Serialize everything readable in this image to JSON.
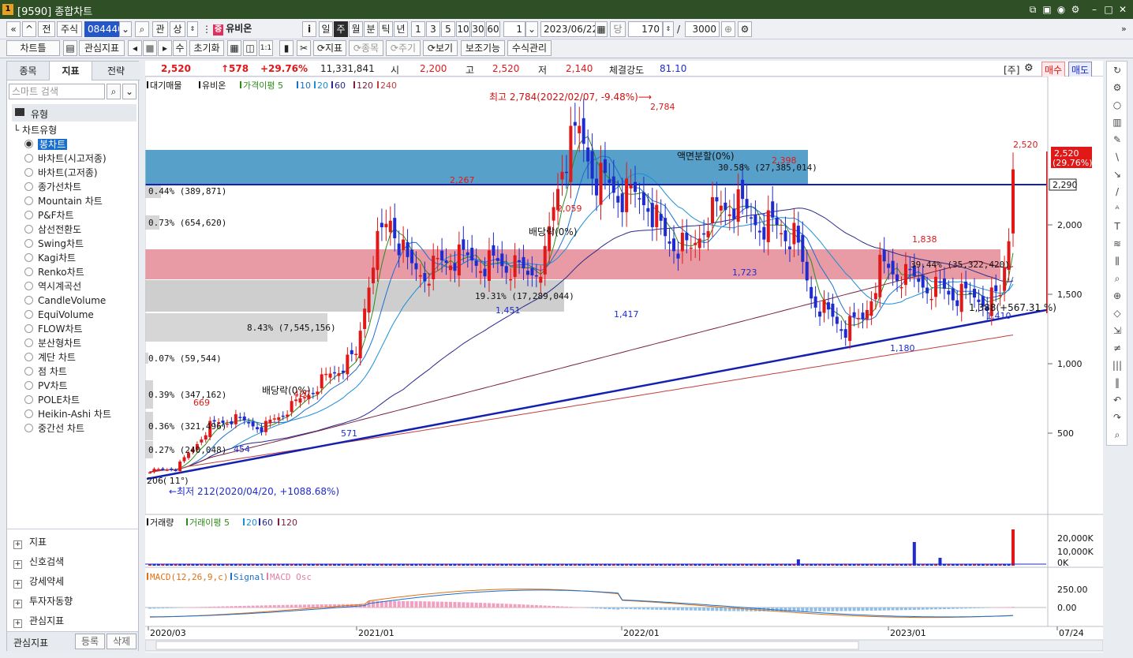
{
  "window": {
    "title": "[9590] 종합차트",
    "badge1": "1",
    "badge2": "?"
  },
  "toolbar1": {
    "nav1": "«",
    "nav2": "≈",
    "prev": "전",
    "type": "주식",
    "code": "084440",
    "btn_gwan": "관",
    "btn_sang": "상",
    "stock_name": "유비온",
    "stock_badge": "증",
    "periods": [
      "일",
      "주",
      "월",
      "분",
      "틱",
      "년"
    ],
    "active_period": "주",
    "nums": [
      "1",
      "3",
      "5",
      "10",
      "30",
      "60"
    ],
    "unit": "1",
    "date": "2023/06/22",
    "dang": "당",
    "count": "170",
    "slash": "/",
    "total": "3000"
  },
  "toolbar2": {
    "chart_btn": "차트틀",
    "fav_btn": "관심지표",
    "su": "수",
    "reset": "초기화",
    "indicator": "지표",
    "jongmok": "종목",
    "jugi": "주기",
    "view": "보기",
    "aux": "보조기능",
    "formula": "수식관리"
  },
  "left_panel": {
    "tabs": [
      "종목",
      "지표",
      "전략"
    ],
    "active_tab": "지표",
    "search_placeholder": "스마트 검색",
    "folder": "유형",
    "group": "차트유형",
    "chart_types": [
      "봉차트",
      "바차트(시고저종)",
      "바차트(고저종)",
      "종가선차트",
      "Mountain 차트",
      "P&F차트",
      "삼선전환도",
      "Swing차트",
      "Kagi차트",
      "Renko차트",
      "역시계곡선",
      "CandleVolume",
      "EquiVolume",
      "FLOW차트",
      "분산형차트",
      "계단 차트",
      "점 차트",
      "PV차트",
      "POLE차트",
      "Heikin-Ashi 차트",
      "중간선 차트"
    ],
    "selected": "봉차트",
    "sections": [
      "지표",
      "신호검색",
      "강세약세",
      "투자자동향",
      "관심지표"
    ],
    "footer_label": "관심지표",
    "footer_register": "등록",
    "footer_delete": "삭제"
  },
  "info": {
    "price": "2,520",
    "change": "↑578",
    "pct": "+29.76%",
    "volume": "11,331,841",
    "open_l": "시",
    "open": "2,200",
    "high_l": "고",
    "high": "2,520",
    "low_l": "저",
    "low": "2,140",
    "str_l": "체결강도",
    "str": "81.10",
    "ju": "[주]",
    "buy": "매수",
    "sell": "매도"
  },
  "price_legend": {
    "a": "대기매물",
    "b": "유비온",
    "c": "가격이평 5",
    "d": "10",
    "e": "20",
    "f": "60",
    "g": "120",
    "h": "240"
  },
  "annotations": {
    "high": "최고 2,784(2022/02/07, -9.48%)",
    "low": "←최저 212(2020/04/20, +1088.68%)",
    "div1": "배당락(0%)",
    "div2": "배당락(0%)",
    "split": "액면분할(0%)",
    "trend1": "1,388(+567.31 %)",
    "angle": "206( 11°)"
  },
  "point_labels": [
    "2,784",
    "2,267",
    "2,059",
    "2,398",
    "2,520",
    "1,838",
    "1,723",
    "1,451",
    "1,417",
    "1,180",
    "1,410",
    "669",
    "571",
    "454",
    "420"
  ],
  "price_axis": {
    "ticks": [
      "2,000",
      "1,500",
      "1,000",
      "500"
    ],
    "last": "2,520",
    "last_pct": "(29.76%)",
    "line": "2,290"
  },
  "volume_profile": [
    "0.44% (389,871)",
    "0.73% (654,620)",
    "30.58% (27,385,014)",
    "39.44% (35,322,420)",
    "19.31% (17,289,044)",
    "8.43% (7,545,156)",
    "0.07% (59,544)",
    "0.39% (347,162)",
    "0.36% (321,496)",
    "0.27% (240,048)"
  ],
  "volume_legend": {
    "a": "거래량",
    "b": "거래이평 5",
    "c": "20",
    "d": "60",
    "e": "120"
  },
  "volume_axis": [
    "20,000K",
    "10,000K",
    "0K"
  ],
  "macd_legend": {
    "a": "MACD(12,26,9,c)",
    "b": "Signal",
    "c": "MACD Osc"
  },
  "macd_axis": [
    "250.00",
    "0.00"
  ],
  "x_axis": [
    "2020/03",
    "2021/01",
    "2022/01",
    "2023/01",
    "07/24"
  ],
  "colors": {
    "up": "#e01818",
    "down": "#1d2bd0",
    "ma5": "#2e8b1a",
    "ma10": "#1a6fd0",
    "ma20": "#1a8fd8",
    "ma60": "#2a2a8a",
    "ma120": "#7a2040",
    "ma240": "#c04040",
    "trend": "#1420b0"
  }
}
